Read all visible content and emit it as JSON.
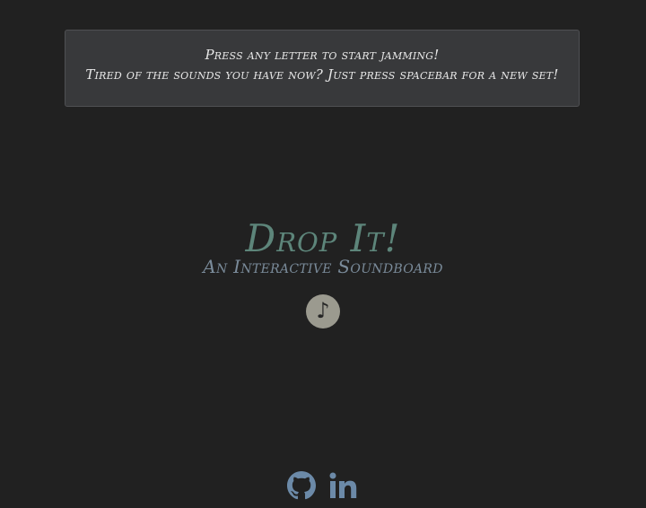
{
  "instructions": {
    "line1": "Press any letter to start jamming!",
    "line2": "Tired of the sounds you have now? Just press spacebar for a new set!"
  },
  "hero": {
    "title": "Drop It!",
    "subtitle": "An Interactive Soundboard"
  },
  "play_button": {
    "icon": "music-note-icon",
    "glyph": "♪"
  },
  "social": {
    "links": [
      {
        "icon": "github-icon"
      },
      {
        "icon": "linkedin-icon"
      }
    ],
    "color": "#6c8aa8"
  },
  "colors": {
    "background": "#212121",
    "panel": "#38393b",
    "title": "#5d857a",
    "subtitle": "#7a8b9a",
    "play_button": "#9b9a8f"
  }
}
